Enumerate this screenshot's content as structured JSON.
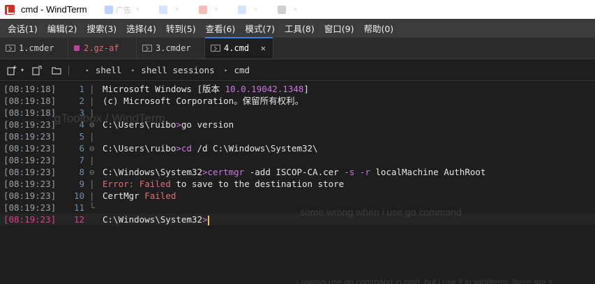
{
  "window": {
    "title": "cmd - WindTerm"
  },
  "browser_ghost_tabs": [
    {
      "label": "广告",
      "color": "#4285f4"
    },
    {
      "label": "",
      "color": "#8ab4f8"
    },
    {
      "label": "",
      "color": "#e94235"
    },
    {
      "label": "",
      "color": "#8ab4f8"
    },
    {
      "label": "",
      "color": "#777777"
    }
  ],
  "menu": {
    "items": [
      "会话(1)",
      "编辑(2)",
      "搜索(3)",
      "选择(4)",
      "转到(5)",
      "查看(6)",
      "模式(7)",
      "工具(8)",
      "窗口(9)",
      "帮助(0)"
    ]
  },
  "tabs": [
    {
      "label": "1.cmder",
      "icon": "terminal-icon",
      "active": false,
      "accent": ""
    },
    {
      "label": "2.gz-af",
      "icon": "square-dot-icon",
      "active": false,
      "accent": "#c040a0"
    },
    {
      "label": "3.cmder",
      "icon": "terminal-icon",
      "active": false,
      "accent": ""
    },
    {
      "label": "4.cmd",
      "icon": "terminal-icon",
      "active": true,
      "accent": "",
      "close": "✕"
    }
  ],
  "toolbar": {
    "breadcrumbs": [
      "shell",
      "shell sessions",
      "cmd"
    ]
  },
  "terminal": {
    "lines": [
      {
        "time": "[08:19:18]",
        "num": "1",
        "fold": "|",
        "parts": [
          {
            "t": "Microsoft Windows [版本 ",
            "c": "plain"
          },
          {
            "t": "10.0.19042.1348",
            "c": "num"
          },
          {
            "t": "]",
            "c": "plain"
          }
        ]
      },
      {
        "time": "[08:19:18]",
        "num": "2",
        "fold": "|",
        "parts": [
          {
            "t": "(c) Microsoft Corporation。保留所有权利。",
            "c": "plain"
          }
        ]
      },
      {
        "time": "[08:19:18]",
        "num": "3",
        "fold": "|",
        "parts": []
      },
      {
        "time": "[08:19:23]",
        "num": "4",
        "fold": "⊖",
        "parts": [
          {
            "t": "C:\\Users\\ruibo",
            "c": "plain"
          },
          {
            "t": ">",
            "c": "cmd"
          },
          {
            "t": "go version",
            "c": "plain"
          }
        ]
      },
      {
        "time": "[08:19:23]",
        "num": "5",
        "fold": "|",
        "parts": []
      },
      {
        "time": "[08:19:23]",
        "num": "6",
        "fold": "⊖",
        "parts": [
          {
            "t": "C:\\Users\\ruibo",
            "c": "plain"
          },
          {
            "t": ">cd",
            "c": "cmd"
          },
          {
            "t": " /d C:\\Windows\\System32\\",
            "c": "plain"
          }
        ]
      },
      {
        "time": "[08:19:23]",
        "num": "7",
        "fold": "|",
        "parts": []
      },
      {
        "time": "[08:19:23]",
        "num": "8",
        "fold": "⊖",
        "parts": [
          {
            "t": "C:\\Windows\\System32",
            "c": "plain"
          },
          {
            "t": ">certmgr",
            "c": "cmd"
          },
          {
            "t": " -add ISCOP-CA.cer ",
            "c": "plain"
          },
          {
            "t": "-s",
            "c": "flag"
          },
          {
            "t": " ",
            "c": "plain"
          },
          {
            "t": "-r",
            "c": "flag"
          },
          {
            "t": " localMachine AuthRoot",
            "c": "plain"
          }
        ]
      },
      {
        "time": "[08:19:23]",
        "num": "9",
        "fold": "|",
        "parts": [
          {
            "t": "Error: ",
            "c": "red"
          },
          {
            "t": "Failed",
            "c": "red"
          },
          {
            "t": " to save to the destination store",
            "c": "plain"
          }
        ]
      },
      {
        "time": "[08:19:23]",
        "num": "10",
        "fold": "|",
        "parts": [
          {
            "t": "CertMgr ",
            "c": "plain"
          },
          {
            "t": "Failed",
            "c": "red"
          }
        ]
      },
      {
        "time": "[08:19:23]",
        "num": "11",
        "fold": "└",
        "parts": []
      },
      {
        "time": "[08:19:23]",
        "num": "12",
        "fold": "",
        "current": true,
        "parts": [
          {
            "t": "C:\\Windows\\System32",
            "c": "plain"
          },
          {
            "t": ">",
            "c": "cmd"
          }
        ]
      }
    ]
  },
  "colors": {
    "accent_blue": "#3b7ddd",
    "prompt_purple": "#c678dd",
    "error_red": "#e06c75",
    "current_line_pink": "#e0408a"
  },
  "background_watermark": {
    "repo": "gToolbox / WindTerm",
    "issue_title": "some wrong when i use go command",
    "body_text": "i always use go command in cmd, but i use it in windterm, there are s"
  }
}
